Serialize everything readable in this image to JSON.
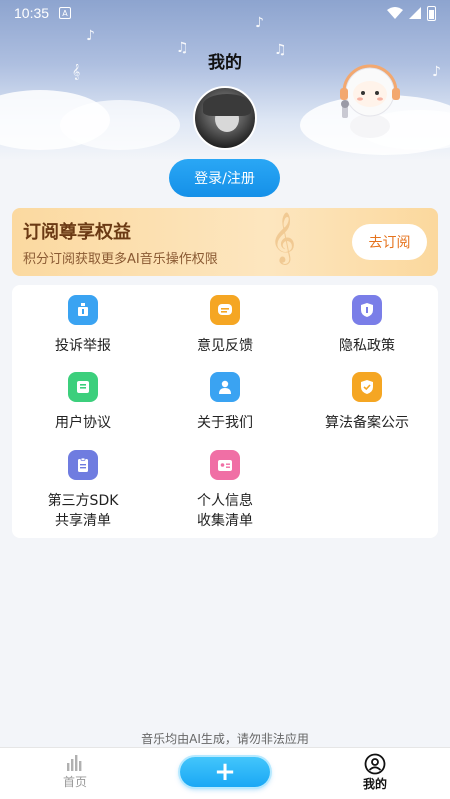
{
  "status_bar": {
    "time": "10:35",
    "notif_letter": "A"
  },
  "header": {
    "title": "我的"
  },
  "profile": {
    "login_label": "登录/注册"
  },
  "subscription": {
    "title": "订阅尊享权益",
    "description": "积分订阅获取更多AI音乐操作权限",
    "button_label": "去订阅"
  },
  "grid": [
    {
      "label": "投诉举报",
      "icon": "report-icon",
      "color": "#3aa3f2"
    },
    {
      "label": "意见反馈",
      "icon": "feedback-icon",
      "color": "#f5a623"
    },
    {
      "label": "隐私政策",
      "icon": "privacy-shield-icon",
      "color": "#7a7ee8"
    },
    {
      "label": "用户协议",
      "icon": "user-agreement-icon",
      "color": "#3ccf7c"
    },
    {
      "label": "关于我们",
      "icon": "about-us-icon",
      "color": "#3aa3f2"
    },
    {
      "label": "算法备案公示",
      "icon": "algorithm-filing-icon",
      "color": "#f5a623"
    },
    {
      "label": "第三方SDK\n共享清单",
      "icon": "sdk-list-icon",
      "color": "#6f7ce0"
    },
    {
      "label": "个人信息\n收集清单",
      "icon": "personal-info-icon",
      "color": "#f06fa5"
    }
  ],
  "footer_note": "音乐均由AI生成，请勿非法应用",
  "tabbar": {
    "home_label": "首页",
    "add_label": "+",
    "mine_label": "我的"
  }
}
